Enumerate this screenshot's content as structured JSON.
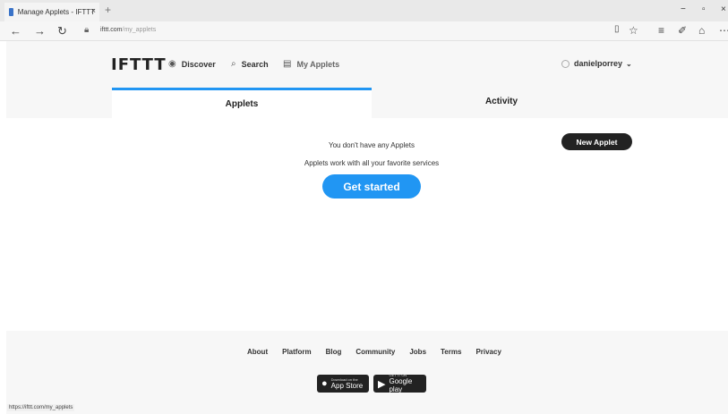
{
  "browser": {
    "tab_title": "Manage Applets - IFTTT",
    "tab_close": "×",
    "new_tab": "+",
    "minimize": "−",
    "restore": "▫",
    "close": "×",
    "back": "←",
    "forward": "→",
    "refresh": "↻",
    "url_host": "ifttt.com",
    "url_path": "/my_applets",
    "status_url": "https://ifttt.com/my_applets"
  },
  "header": {
    "logo": "IFTTT",
    "nav": [
      {
        "label": "Discover",
        "icon": "eye-icon"
      },
      {
        "label": "Search",
        "icon": "search-icon"
      },
      {
        "label": "My Applets",
        "icon": "applets-icon"
      }
    ],
    "username": "danielporrey"
  },
  "tabs": {
    "applets": "Applets",
    "activity": "Activity",
    "active": "Applets"
  },
  "main": {
    "new_applet": "New Applet",
    "empty_title": "You don't have any Applets",
    "empty_subtitle": "Applets work with all your favorite services",
    "get_started": "Get started"
  },
  "footer": {
    "links": [
      "About",
      "Platform",
      "Blog",
      "Community",
      "Jobs",
      "Terms",
      "Privacy"
    ],
    "app_store_small": "Download on the",
    "app_store": "App Store",
    "google_play_small": "GET IT ON",
    "google_play": "Google play"
  },
  "colors": {
    "accent": "#2196f3",
    "dark_button": "#222222",
    "header_bg": "#f7f7f7"
  }
}
